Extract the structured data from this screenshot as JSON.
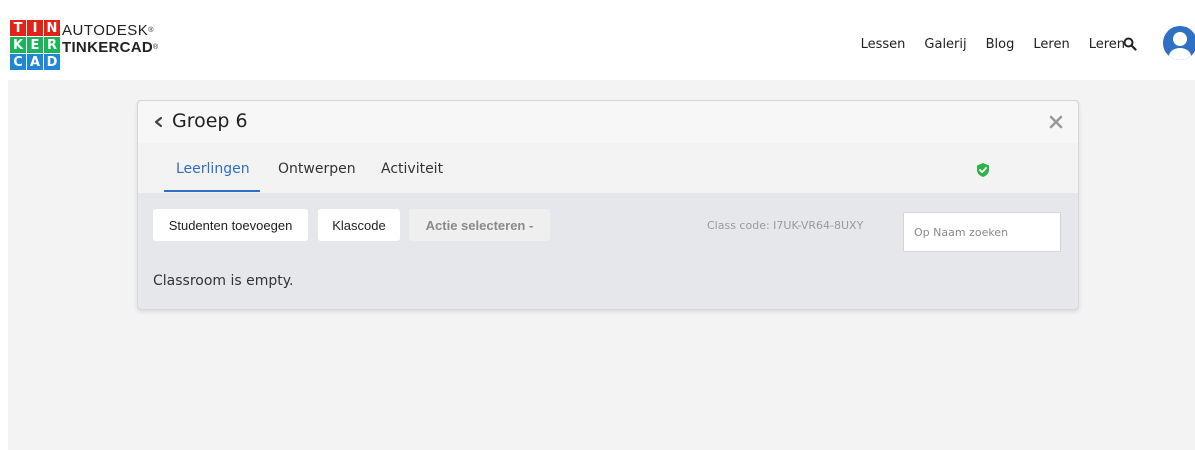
{
  "brand": {
    "logo_letters": [
      "T",
      "I",
      "N",
      "K",
      "E",
      "R",
      "C",
      "A",
      "D"
    ],
    "logo_colors": [
      "#e2231a",
      "#e2231a",
      "#e2231a",
      "#1cb45a",
      "#1cb45a",
      "#1cb45a",
      "#1e88d6",
      "#1e88d6",
      "#1e88d6"
    ],
    "line1": "AUTODESK",
    "line2": "TINKERCAD",
    "trademark": "®"
  },
  "nav": {
    "items": [
      "Lessen",
      "Galerij",
      "Blog",
      "Leren",
      "Leren"
    ],
    "search_icon": "search-icon",
    "avatar_icon": "user-avatar-icon"
  },
  "panel": {
    "title": "Groep 6",
    "back_icon": "chevron-left-icon",
    "close_icon": "close-icon",
    "tabs": [
      {
        "label": "Leerlingen",
        "active": true
      },
      {
        "label": "Ontwerpen",
        "active": false
      },
      {
        "label": "Activiteit",
        "active": false
      }
    ],
    "shield_icon": "shield-check-icon",
    "buttons": {
      "add_students": "Studenten toevoegen",
      "class_code": "Klascode",
      "select_action": "Actie selecteren -"
    },
    "class_code_text": "Class code: I7UK-VR64-8UXY",
    "search_placeholder": "Op Naam zoeken",
    "empty_message": "Classroom is empty."
  },
  "colors": {
    "accent": "#2f6fc4",
    "success": "#2db34a",
    "page_bg": "#f3f3f4",
    "panel_bg": "#e6e7ea"
  }
}
